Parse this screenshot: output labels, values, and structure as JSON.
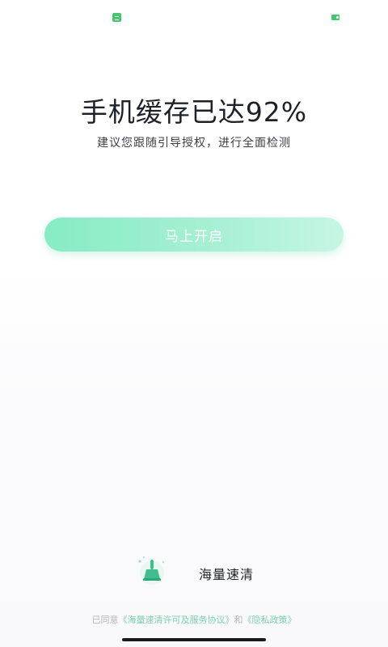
{
  "status_bar": {
    "left_icon": "app-notification-icon",
    "right_icon": "battery-icon",
    "accent_color": "#49c572"
  },
  "main": {
    "headline": "手机缓存已达92%",
    "subline": "建议您跟随引导授权，进行全面检测",
    "start_button_label": "马上开启"
  },
  "brand": {
    "logo_icon": "broom-cleaner-icon",
    "app_name": "海量速清"
  },
  "agreement": {
    "prefix": "已同意",
    "license_link": "《海量速清许可及服务协议》",
    "conjunction": "和",
    "privacy_link": "《隐私政策》"
  },
  "colors": {
    "button_gradient_start": "#86ecc4",
    "button_gradient_end": "#c6f6e4",
    "link_color": "#7ccfb0"
  }
}
